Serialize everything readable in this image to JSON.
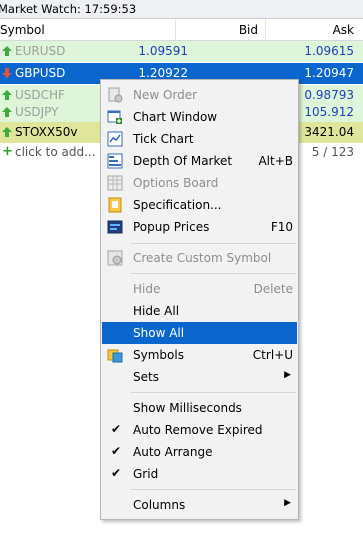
{
  "window": {
    "title": "Market Watch: 17:59:53"
  },
  "table": {
    "columns": [
      "Symbol",
      "Bid",
      "Ask"
    ],
    "rows": [
      {
        "symbol": "EURUSD",
        "bid": "1.09591",
        "ask": "1.09615",
        "direction": "up"
      },
      {
        "symbol": "GBPUSD",
        "bid": "1.20922",
        "ask": "1.20947",
        "direction": "down"
      },
      {
        "symbol": "USDCHF",
        "bid": "",
        "ask": "0.98793",
        "direction": "up"
      },
      {
        "symbol": "USDJPY",
        "bid": "",
        "ask": "105.912",
        "direction": "up"
      },
      {
        "symbol": "STOXX50v",
        "bid": "",
        "ask": "3421.04",
        "direction": "up"
      }
    ],
    "add_label": "click to add...",
    "count": "5 / 123"
  },
  "context_menu": {
    "items": [
      {
        "label": "New Order",
        "shortcut": "",
        "icon": "new-order-icon",
        "disabled": true
      },
      {
        "label": "Chart Window",
        "shortcut": "",
        "icon": "chart-window-icon",
        "disabled": false
      },
      {
        "label": "Tick Chart",
        "shortcut": "",
        "icon": "tick-chart-icon",
        "disabled": false
      },
      {
        "label": "Depth Of Market",
        "shortcut": "Alt+B",
        "icon": "depth-of-market-icon",
        "disabled": false
      },
      {
        "label": "Options Board",
        "shortcut": "",
        "icon": "options-board-icon",
        "disabled": true
      },
      {
        "label": "Specification...",
        "shortcut": "",
        "icon": "specification-icon",
        "disabled": false
      },
      {
        "label": "Popup Prices",
        "shortcut": "F10",
        "icon": "popup-prices-icon",
        "disabled": false
      },
      {
        "label": "Create Custom Symbol",
        "shortcut": "",
        "icon": "custom-symbol-icon",
        "disabled": true
      },
      {
        "label": "Hide",
        "shortcut": "Delete",
        "disabled": true
      },
      {
        "label": "Hide All",
        "shortcut": "",
        "disabled": false
      },
      {
        "label": "Show All",
        "shortcut": "",
        "disabled": false,
        "highlighted": true
      },
      {
        "label": "Symbols",
        "shortcut": "Ctrl+U",
        "icon": "symbols-icon",
        "disabled": false
      },
      {
        "label": "Sets",
        "shortcut": "",
        "disabled": false,
        "submenu": true
      },
      {
        "label": "Show Milliseconds",
        "shortcut": "",
        "disabled": false,
        "checked": false
      },
      {
        "label": "Auto Remove Expired",
        "shortcut": "",
        "disabled": false,
        "checked": true
      },
      {
        "label": "Auto Arrange",
        "shortcut": "",
        "disabled": false,
        "checked": true
      },
      {
        "label": "Grid",
        "shortcut": "",
        "disabled": false,
        "checked": true
      },
      {
        "label": "Columns",
        "shortcut": "",
        "disabled": false,
        "submenu": true
      }
    ]
  },
  "colors": {
    "selected_row": "#0a66cc",
    "up_row": "#dff5d9",
    "highlight_row": "#dfe59a",
    "price_text": "#1d3fb8"
  }
}
